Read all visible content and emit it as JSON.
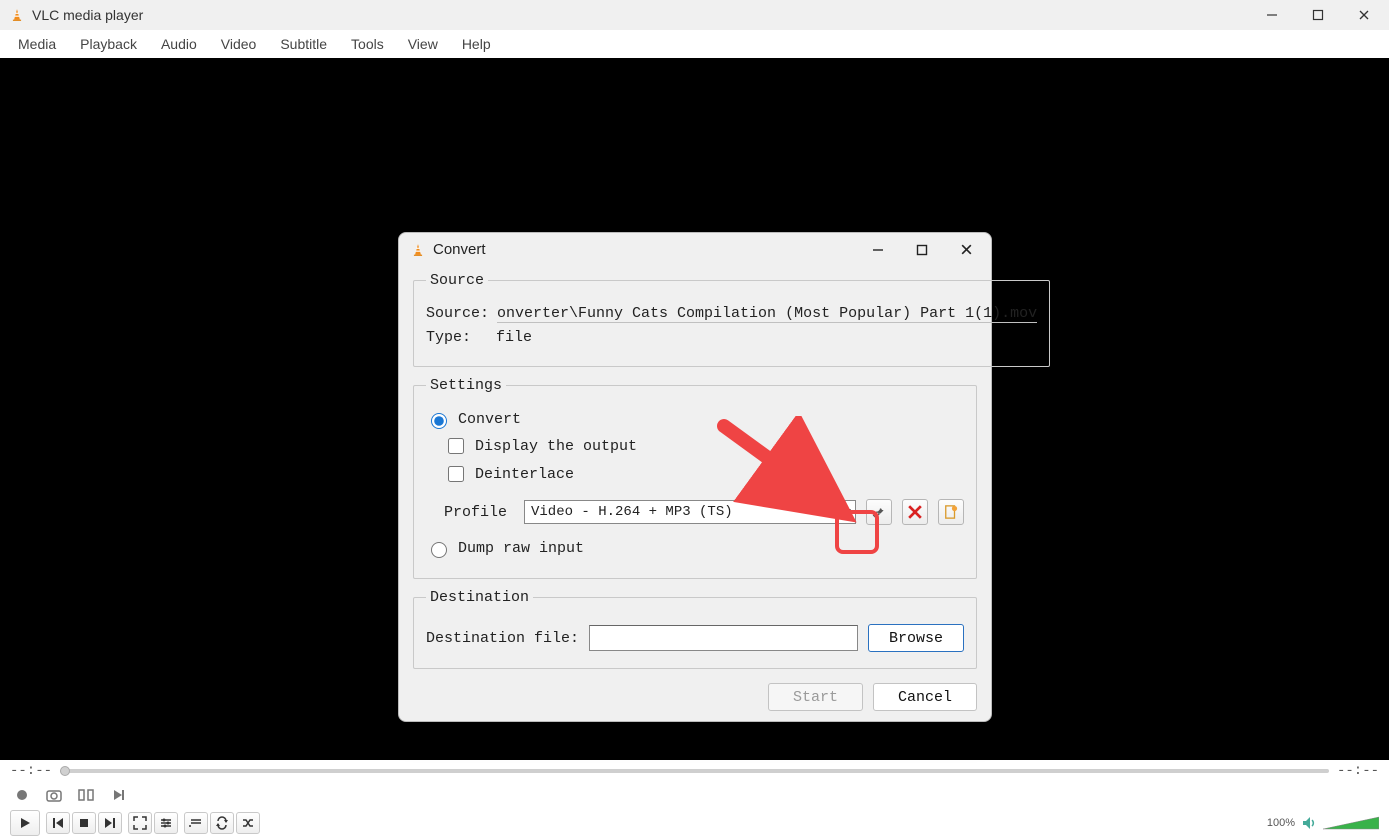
{
  "window": {
    "title": "VLC media player",
    "time_elapsed": "--:--",
    "time_total": "--:--",
    "volume_label": "100%"
  },
  "menubar": [
    "Media",
    "Playback",
    "Audio",
    "Video",
    "Subtitle",
    "Tools",
    "View",
    "Help"
  ],
  "dialog": {
    "title": "Convert",
    "source_group": "Source",
    "source_label": "Source:",
    "source_value": "onverter\\Funny Cats Compilation (Most Popular) Part 1(1).mov",
    "type_label": "Type:",
    "type_value": "file",
    "settings_group": "Settings",
    "convert_radio": "Convert",
    "display_output_check": "Display the output",
    "deinterlace_check": "Deinterlace",
    "profile_label": "Profile",
    "profile_value": "Video - H.264 + MP3 (TS)",
    "dump_radio": "Dump raw input",
    "destination_group": "Destination",
    "destination_label": "Destination file:",
    "browse_label": "Browse",
    "start_label": "Start",
    "cancel_label": "Cancel"
  }
}
